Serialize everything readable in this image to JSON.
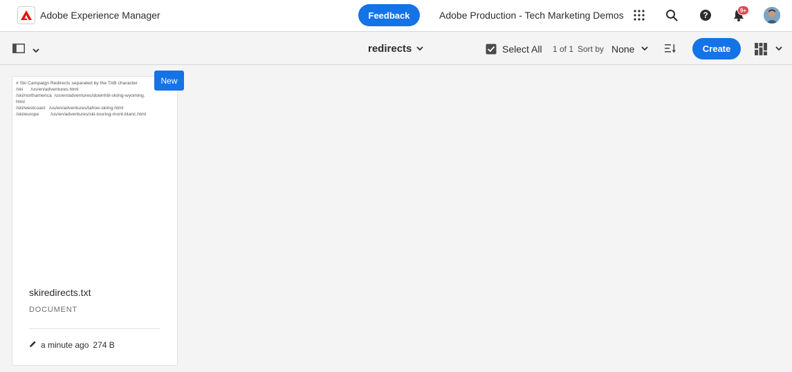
{
  "header": {
    "app_name": "Adobe Experience Manager",
    "feedback_label": "Feedback",
    "org_name": "Adobe Production - Tech Marketing Demos",
    "notification_count": "9+",
    "icons": [
      "adobe-logo-icon",
      "apps-grid-icon",
      "search-icon",
      "help-icon",
      "bell-icon",
      "avatar"
    ]
  },
  "actionbar": {
    "rail_toggle_icon": "side-panel-icon",
    "folder_title": "redirects",
    "select_all_label": "Select All",
    "count_text": "1 of 1",
    "sort_by_label": "Sort by",
    "sort_value": "None",
    "create_label": "Create",
    "view_icon": "card-view-icon"
  },
  "card": {
    "preview_text": "# Ski Campaign Redirects separated by the TAB character\n/ski      /us/en/adventures.html\n/ski/northamerica  /us/en/adventures/downhill-skiing-wyoming.\nhtml\n/ski/westcoast   /us/en/adventures/tahoe-skiing.html\n/ski/europe         /us/en/adventures/ski-touring-mont-blanc.html",
    "new_label": "New",
    "title": "skiredirects.txt",
    "type": "DOCUMENT",
    "modified": "a minute ago",
    "size": "274 B"
  },
  "colors": {
    "accent": "#1473e6",
    "adobe_red": "#eb1000",
    "badge_red": "#e34850",
    "background": "#f4f4f4"
  }
}
